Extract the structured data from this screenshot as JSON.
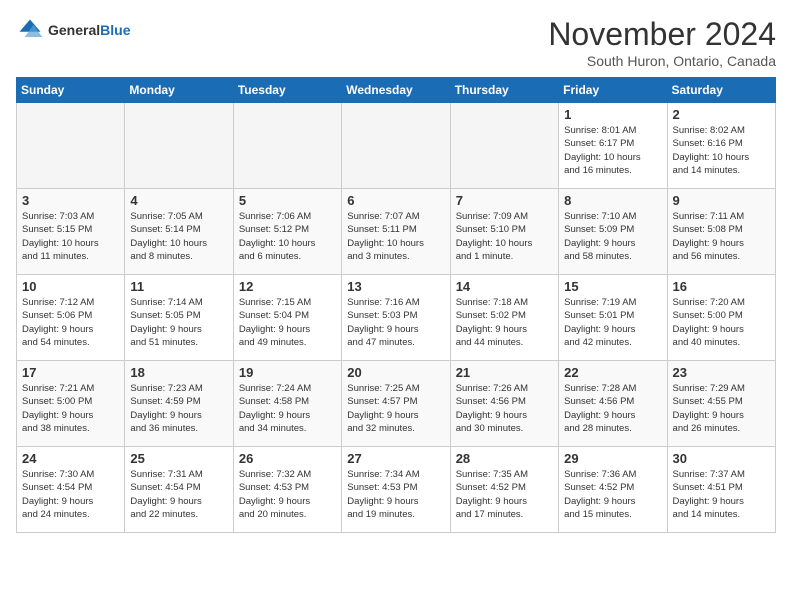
{
  "header": {
    "logo_general": "General",
    "logo_blue": "Blue",
    "month": "November 2024",
    "location": "South Huron, Ontario, Canada"
  },
  "weekdays": [
    "Sunday",
    "Monday",
    "Tuesday",
    "Wednesday",
    "Thursday",
    "Friday",
    "Saturday"
  ],
  "weeks": [
    [
      {
        "day": "",
        "info": ""
      },
      {
        "day": "",
        "info": ""
      },
      {
        "day": "",
        "info": ""
      },
      {
        "day": "",
        "info": ""
      },
      {
        "day": "",
        "info": ""
      },
      {
        "day": "1",
        "info": "Sunrise: 8:01 AM\nSunset: 6:17 PM\nDaylight: 10 hours\nand 16 minutes."
      },
      {
        "day": "2",
        "info": "Sunrise: 8:02 AM\nSunset: 6:16 PM\nDaylight: 10 hours\nand 14 minutes."
      }
    ],
    [
      {
        "day": "3",
        "info": "Sunrise: 7:03 AM\nSunset: 5:15 PM\nDaylight: 10 hours\nand 11 minutes."
      },
      {
        "day": "4",
        "info": "Sunrise: 7:05 AM\nSunset: 5:14 PM\nDaylight: 10 hours\nand 8 minutes."
      },
      {
        "day": "5",
        "info": "Sunrise: 7:06 AM\nSunset: 5:12 PM\nDaylight: 10 hours\nand 6 minutes."
      },
      {
        "day": "6",
        "info": "Sunrise: 7:07 AM\nSunset: 5:11 PM\nDaylight: 10 hours\nand 3 minutes."
      },
      {
        "day": "7",
        "info": "Sunrise: 7:09 AM\nSunset: 5:10 PM\nDaylight: 10 hours\nand 1 minute."
      },
      {
        "day": "8",
        "info": "Sunrise: 7:10 AM\nSunset: 5:09 PM\nDaylight: 9 hours\nand 58 minutes."
      },
      {
        "day": "9",
        "info": "Sunrise: 7:11 AM\nSunset: 5:08 PM\nDaylight: 9 hours\nand 56 minutes."
      }
    ],
    [
      {
        "day": "10",
        "info": "Sunrise: 7:12 AM\nSunset: 5:06 PM\nDaylight: 9 hours\nand 54 minutes."
      },
      {
        "day": "11",
        "info": "Sunrise: 7:14 AM\nSunset: 5:05 PM\nDaylight: 9 hours\nand 51 minutes."
      },
      {
        "day": "12",
        "info": "Sunrise: 7:15 AM\nSunset: 5:04 PM\nDaylight: 9 hours\nand 49 minutes."
      },
      {
        "day": "13",
        "info": "Sunrise: 7:16 AM\nSunset: 5:03 PM\nDaylight: 9 hours\nand 47 minutes."
      },
      {
        "day": "14",
        "info": "Sunrise: 7:18 AM\nSunset: 5:02 PM\nDaylight: 9 hours\nand 44 minutes."
      },
      {
        "day": "15",
        "info": "Sunrise: 7:19 AM\nSunset: 5:01 PM\nDaylight: 9 hours\nand 42 minutes."
      },
      {
        "day": "16",
        "info": "Sunrise: 7:20 AM\nSunset: 5:00 PM\nDaylight: 9 hours\nand 40 minutes."
      }
    ],
    [
      {
        "day": "17",
        "info": "Sunrise: 7:21 AM\nSunset: 5:00 PM\nDaylight: 9 hours\nand 38 minutes."
      },
      {
        "day": "18",
        "info": "Sunrise: 7:23 AM\nSunset: 4:59 PM\nDaylight: 9 hours\nand 36 minutes."
      },
      {
        "day": "19",
        "info": "Sunrise: 7:24 AM\nSunset: 4:58 PM\nDaylight: 9 hours\nand 34 minutes."
      },
      {
        "day": "20",
        "info": "Sunrise: 7:25 AM\nSunset: 4:57 PM\nDaylight: 9 hours\nand 32 minutes."
      },
      {
        "day": "21",
        "info": "Sunrise: 7:26 AM\nSunset: 4:56 PM\nDaylight: 9 hours\nand 30 minutes."
      },
      {
        "day": "22",
        "info": "Sunrise: 7:28 AM\nSunset: 4:56 PM\nDaylight: 9 hours\nand 28 minutes."
      },
      {
        "day": "23",
        "info": "Sunrise: 7:29 AM\nSunset: 4:55 PM\nDaylight: 9 hours\nand 26 minutes."
      }
    ],
    [
      {
        "day": "24",
        "info": "Sunrise: 7:30 AM\nSunset: 4:54 PM\nDaylight: 9 hours\nand 24 minutes."
      },
      {
        "day": "25",
        "info": "Sunrise: 7:31 AM\nSunset: 4:54 PM\nDaylight: 9 hours\nand 22 minutes."
      },
      {
        "day": "26",
        "info": "Sunrise: 7:32 AM\nSunset: 4:53 PM\nDaylight: 9 hours\nand 20 minutes."
      },
      {
        "day": "27",
        "info": "Sunrise: 7:34 AM\nSunset: 4:53 PM\nDaylight: 9 hours\nand 19 minutes."
      },
      {
        "day": "28",
        "info": "Sunrise: 7:35 AM\nSunset: 4:52 PM\nDaylight: 9 hours\nand 17 minutes."
      },
      {
        "day": "29",
        "info": "Sunrise: 7:36 AM\nSunset: 4:52 PM\nDaylight: 9 hours\nand 15 minutes."
      },
      {
        "day": "30",
        "info": "Sunrise: 7:37 AM\nSunset: 4:51 PM\nDaylight: 9 hours\nand 14 minutes."
      }
    ]
  ]
}
